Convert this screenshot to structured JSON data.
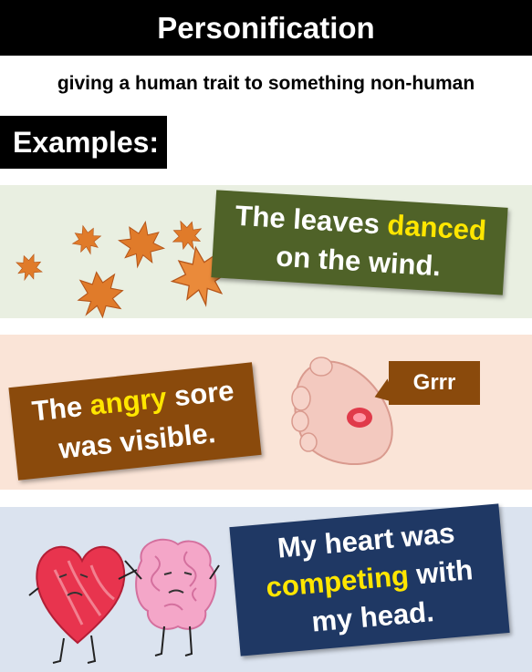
{
  "header": {
    "title": "Personification"
  },
  "definition": "giving a human trait to something non-human",
  "examples_label": "Examples:",
  "examples": [
    {
      "before": "The leaves ",
      "highlight": "danced",
      "after": "on the wind.",
      "bg": "#4f6228"
    },
    {
      "before": "The ",
      "highlight": "angry",
      "after": " sore",
      "line2": "was visible.",
      "bubble": "Grrr",
      "bg": "#8a4a0c"
    },
    {
      "line1": "My heart was",
      "highlight": "competing",
      "after": " with",
      "line3": "my head.",
      "bg": "#1f3864"
    }
  ],
  "colors": {
    "highlight": "#ffe600",
    "leaf": "#e07b2a",
    "heart": "#e8344e",
    "brain": "#f4a6c8"
  },
  "icons": [
    "maple-leaf-icon",
    "sore-foot-icon",
    "heart-character-icon",
    "brain-character-icon"
  ]
}
